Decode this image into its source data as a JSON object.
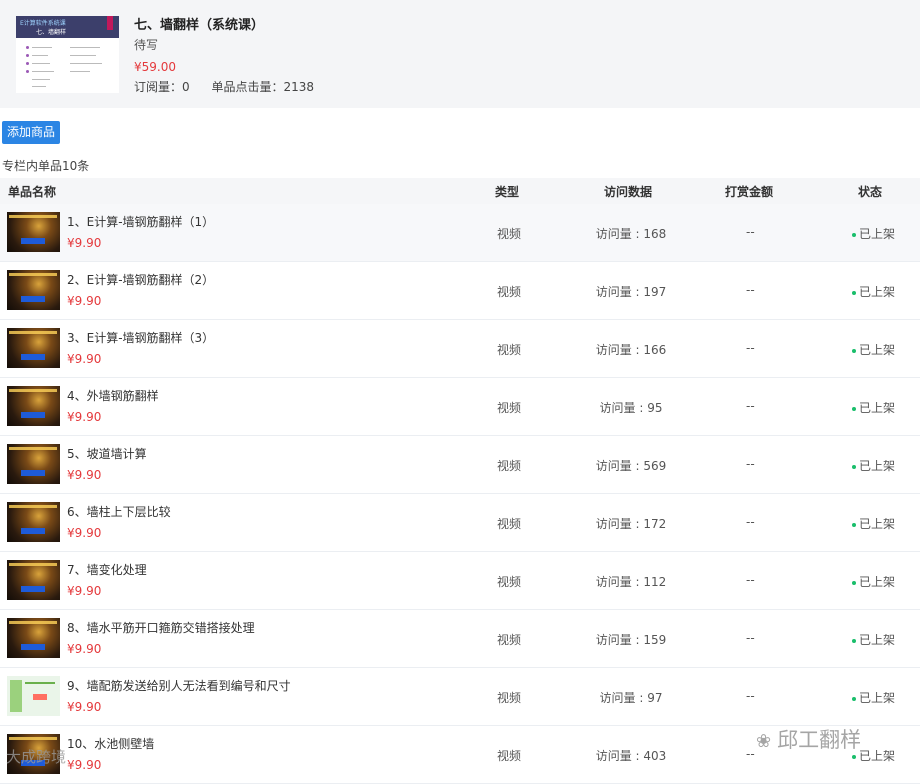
{
  "course": {
    "title": "七、墙翻样（系统课）",
    "author": "待写",
    "price": "¥59.00",
    "subscriptions": "订阅量：0",
    "clicks": "单品点击量：2138",
    "cover_text_1": "E计算软件系统课",
    "cover_text_2": "七、墙翻样",
    "cover_tag_color": "#c2185b"
  },
  "actions": {
    "add_label": "添加商品"
  },
  "summary": "专栏内单品10条",
  "table": {
    "headers": {
      "name": "单品名称",
      "type": "类型",
      "visits": "访问数据",
      "tips": "打赏金额",
      "status": "状态"
    },
    "rows": [
      {
        "name": "1、E计算-墙钢筋翻样（1）",
        "price": "¥9.90",
        "type": "视频",
        "visits": "访问量 : 168",
        "tips": "--",
        "status": "已上架",
        "thumb": "dark"
      },
      {
        "name": "2、E计算-墙钢筋翻样（2）",
        "price": "¥9.90",
        "type": "视频",
        "visits": "访问量 : 197",
        "tips": "--",
        "status": "已上架",
        "thumb": "dark"
      },
      {
        "name": "3、E计算-墙钢筋翻样（3）",
        "price": "¥9.90",
        "type": "视频",
        "visits": "访问量 : 166",
        "tips": "--",
        "status": "已上架",
        "thumb": "dark"
      },
      {
        "name": "4、外墙钢筋翻样",
        "price": "¥9.90",
        "type": "视频",
        "visits": "访问量 : 95",
        "tips": "--",
        "status": "已上架",
        "thumb": "dark"
      },
      {
        "name": "5、坡道墙计算",
        "price": "¥9.90",
        "type": "视频",
        "visits": "访问量 : 569",
        "tips": "--",
        "status": "已上架",
        "thumb": "dark"
      },
      {
        "name": "6、墙柱上下层比较",
        "price": "¥9.90",
        "type": "视频",
        "visits": "访问量 : 172",
        "tips": "--",
        "status": "已上架",
        "thumb": "dark"
      },
      {
        "name": "7、墙变化处理",
        "price": "¥9.90",
        "type": "视频",
        "visits": "访问量 : 112",
        "tips": "--",
        "status": "已上架",
        "thumb": "dark"
      },
      {
        "name": "8、墙水平筋开口箍筋交错搭接处理",
        "price": "¥9.90",
        "type": "视频",
        "visits": "访问量 : 159",
        "tips": "--",
        "status": "已上架",
        "thumb": "dark"
      },
      {
        "name": "9、墙配筋发送给别人无法看到编号和尺寸",
        "price": "¥9.90",
        "type": "视频",
        "visits": "访问量 : 97",
        "tips": "--",
        "status": "已上架",
        "thumb": "green"
      },
      {
        "name": "10、水池侧壁墙",
        "price": "¥9.90",
        "type": "视频",
        "visits": "访问量 : 403",
        "tips": "--",
        "status": "已上架",
        "thumb": "dark"
      }
    ]
  },
  "status_color": "#19be6b",
  "price_color": "#e4393c",
  "accent_color": "#2b85e4",
  "watermarks": {
    "right": "邱工翻样",
    "left": "大成跨境"
  }
}
